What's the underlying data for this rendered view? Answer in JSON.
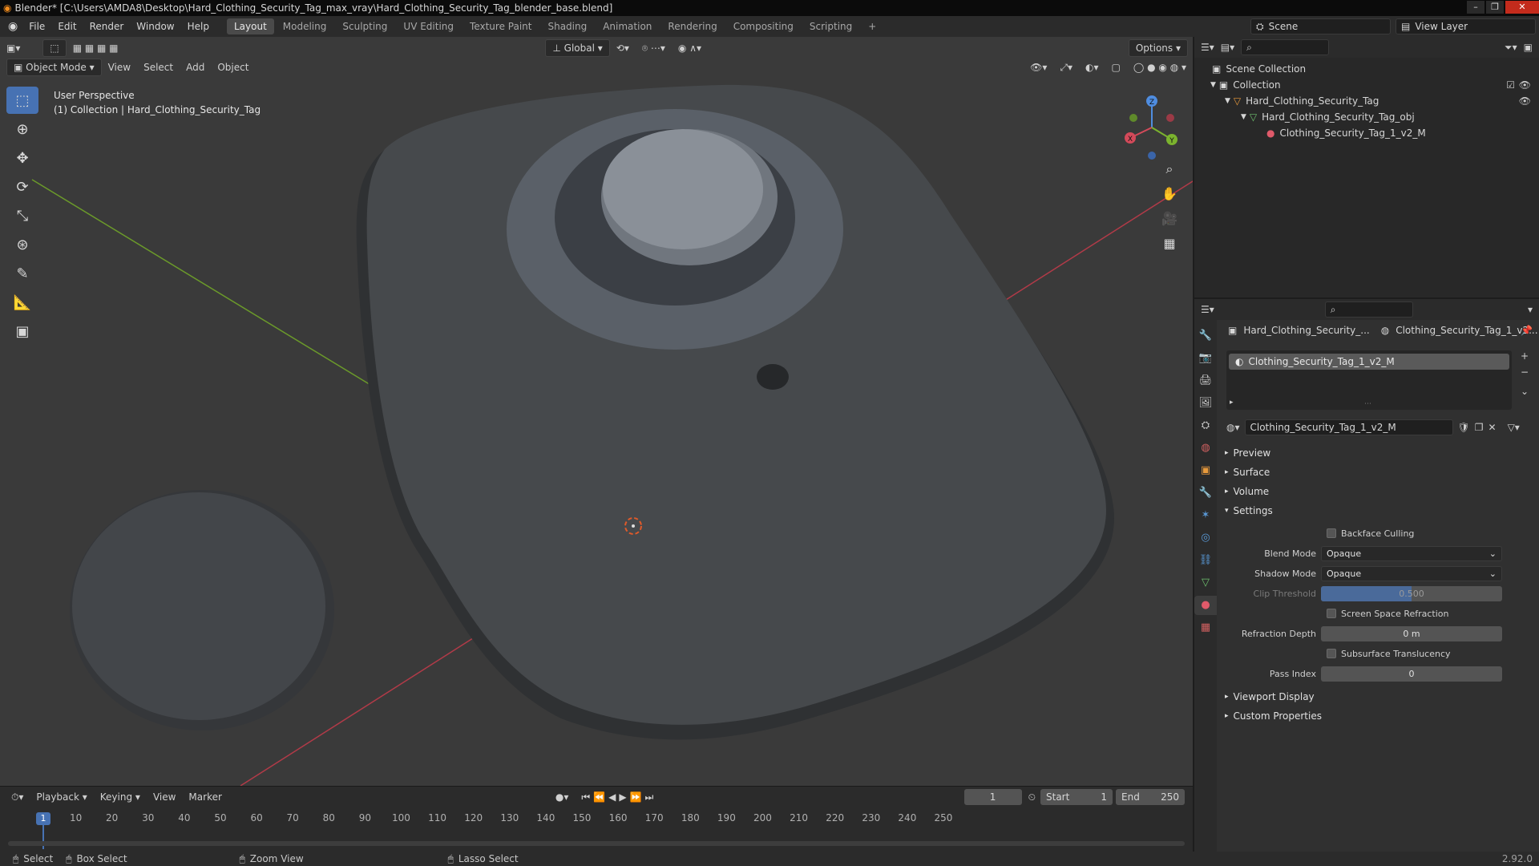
{
  "window": {
    "title": "Blender* [C:\\Users\\AMDA8\\Desktop\\Hard_Clothing_Security_Tag_max_vray\\Hard_Clothing_Security_Tag_blender_base.blend]"
  },
  "menu": {
    "items": [
      "File",
      "Edit",
      "Render",
      "Window",
      "Help"
    ],
    "workspaces": [
      "Layout",
      "Modeling",
      "Sculpting",
      "UV Editing",
      "Texture Paint",
      "Shading",
      "Animation",
      "Rendering",
      "Compositing",
      "Scripting"
    ],
    "active_workspace": "Layout",
    "add_tab": "+",
    "scene": "Scene",
    "view_layer": "View Layer"
  },
  "viewport": {
    "mode": "Object Mode",
    "menus": [
      "View",
      "Select",
      "Add",
      "Object"
    ],
    "transform_orientation": "Global",
    "options": "Options",
    "info_line1": "User Perspective",
    "info_line2": "(1) Collection | Hard_Clothing_Security_Tag",
    "gizmo_axes": {
      "x": "X",
      "y": "Y",
      "z": "Z"
    },
    "colors": {
      "background": "#3a3a3a",
      "axis_x": "#b23a48",
      "axis_y": "#6b9a2a",
      "object": "#4a4c4e",
      "active_tool": "#4772b3"
    }
  },
  "outliner": {
    "rows": [
      {
        "label": "Scene Collection",
        "depth": 0
      },
      {
        "label": "Collection",
        "depth": 1
      },
      {
        "label": "Hard_Clothing_Security_Tag",
        "depth": 2
      },
      {
        "label": "Hard_Clothing_Security_Tag_obj",
        "depth": 3
      },
      {
        "label": "Clothing_Security_Tag_1_v2_M",
        "depth": 4
      }
    ]
  },
  "properties": {
    "breadcrumb_object": "Hard_Clothing_Security_...",
    "breadcrumb_material": "Clothing_Security_Tag_1_v2...",
    "slot": "Clothing_Security_Tag_1_v2_M",
    "material_name": "Clothing_Security_Tag_1_v2_M",
    "panels": {
      "preview": "Preview",
      "surface": "Surface",
      "volume": "Volume",
      "settings": "Settings",
      "viewport_display": "Viewport Display",
      "custom_properties": "Custom Properties"
    },
    "settings": {
      "backface_culling": {
        "label": "Backface Culling",
        "checked": false
      },
      "blend_mode": {
        "label": "Blend Mode",
        "value": "Opaque"
      },
      "shadow_mode": {
        "label": "Shadow Mode",
        "value": "Opaque"
      },
      "clip_threshold": {
        "label": "Clip Threshold",
        "value": "0.500",
        "fraction": 0.5
      },
      "screen_space_refraction": {
        "label": "Screen Space Refraction",
        "checked": false
      },
      "refraction_depth": {
        "label": "Refraction Depth",
        "value": "0 m"
      },
      "subsurface_translucency": {
        "label": "Subsurface Translucency",
        "checked": false
      },
      "pass_index": {
        "label": "Pass Index",
        "value": "0"
      }
    }
  },
  "timeline": {
    "menus": [
      "Playback",
      "Keying",
      "View",
      "Marker"
    ],
    "current_frame": "1",
    "start_label": "Start",
    "start": "1",
    "end_label": "End",
    "end": "250",
    "ticks": [
      "1",
      "10",
      "20",
      "30",
      "40",
      "50",
      "60",
      "70",
      "80",
      "90",
      "100",
      "110",
      "120",
      "130",
      "140",
      "150",
      "160",
      "170",
      "180",
      "190",
      "200",
      "210",
      "220",
      "230",
      "240",
      "250"
    ]
  },
  "statusbar": {
    "select": "Select",
    "box_select": "Box Select",
    "zoom_view": "Zoom View",
    "lasso_select": "Lasso Select",
    "version": "2.92.0"
  }
}
